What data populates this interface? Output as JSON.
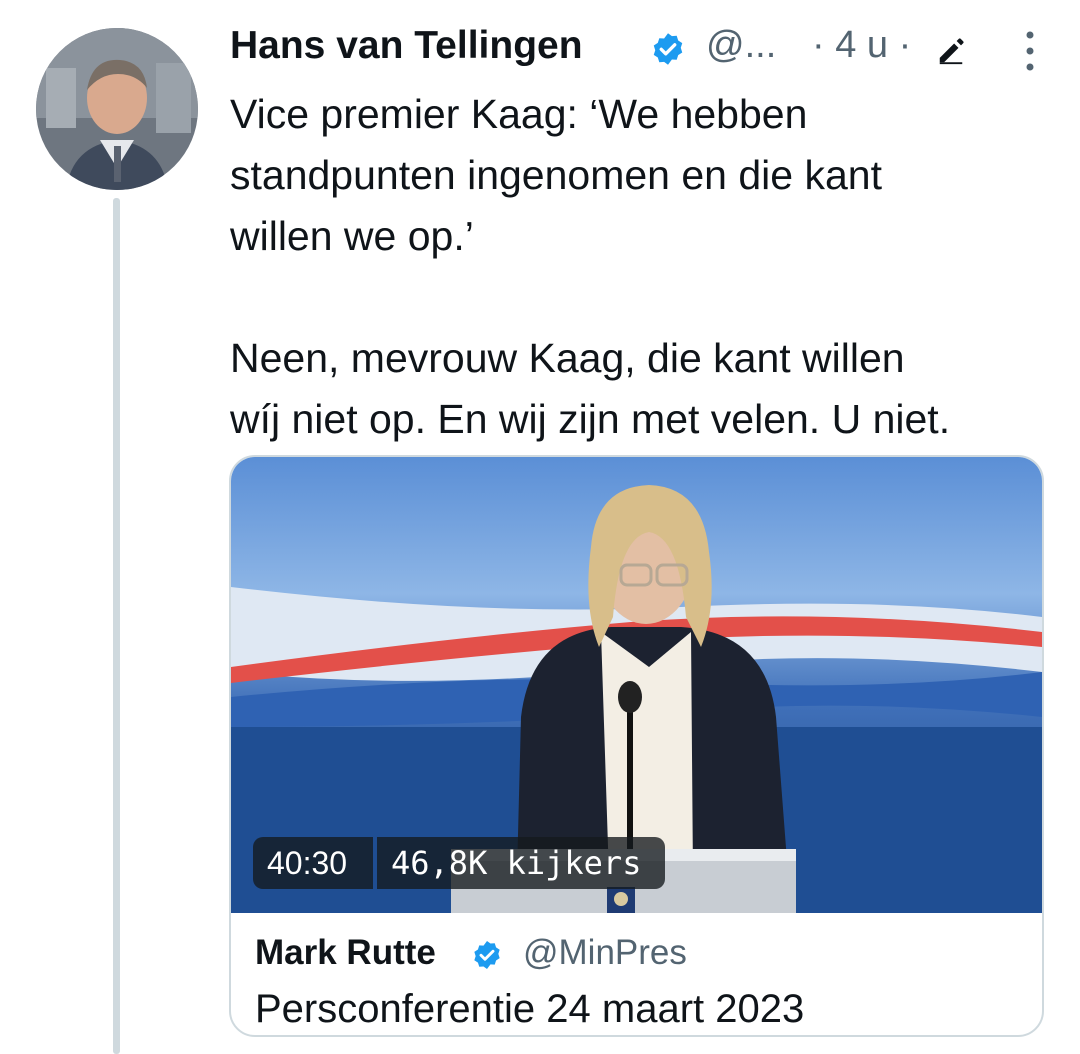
{
  "tweet": {
    "author_name": "Hans van Tellingen",
    "handle": "@...",
    "time": "· 4 u ·",
    "text": "Vice premier Kaag: ‘We hebben\nstandpunten ingenomen en die kant\nwillen we op.’\n\nNeen, mevrouw Kaag, die kant willen\nwíj niet op. En wij zijn met velen. U niet.",
    "icons": {
      "verified": "verified-badge-icon",
      "edit": "pencil-icon",
      "more": "more-vertical-icon"
    }
  },
  "quoted": {
    "video_duration": "40:30",
    "video_viewers": "46,8K kijkers",
    "author_name": "Mark Rutte",
    "handle": "@MinPres",
    "text": "Persconferentie 24 maart 2023"
  },
  "colors": {
    "verified": "#1d9bf0",
    "secondary_text": "#536471",
    "thread_line": "#cfd9de",
    "background_blue": "#1f4e93",
    "stripe_red": "#e3504a"
  }
}
